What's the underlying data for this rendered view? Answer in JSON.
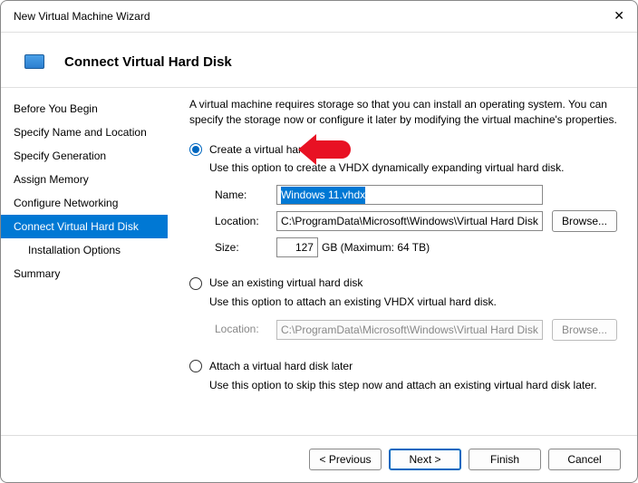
{
  "window": {
    "title": "New Virtual Machine Wizard"
  },
  "header": {
    "title": "Connect Virtual Hard Disk"
  },
  "sidebar": {
    "items": [
      {
        "label": "Before You Begin"
      },
      {
        "label": "Specify Name and Location"
      },
      {
        "label": "Specify Generation"
      },
      {
        "label": "Assign Memory"
      },
      {
        "label": "Configure Networking"
      },
      {
        "label": "Connect Virtual Hard Disk"
      },
      {
        "label": "Installation Options"
      },
      {
        "label": "Summary"
      }
    ]
  },
  "content": {
    "intro": "A virtual machine requires storage so that you can install an operating system. You can specify the storage now or configure it later by modifying the virtual machine's properties.",
    "opt1": {
      "label": "Create a virtual hard disk",
      "desc": "Use this option to create a VHDX dynamically expanding virtual hard disk.",
      "name_label": "Name:",
      "name_value": "Windows 11.vhdx",
      "loc_label": "Location:",
      "loc_value": "C:\\ProgramData\\Microsoft\\Windows\\Virtual Hard Disks\\",
      "browse": "Browse...",
      "size_label": "Size:",
      "size_value": "127",
      "size_unit": "GB (Maximum: 64 TB)"
    },
    "opt2": {
      "label": "Use an existing virtual hard disk",
      "desc": "Use this option to attach an existing VHDX virtual hard disk.",
      "loc_label": "Location:",
      "loc_value": "C:\\ProgramData\\Microsoft\\Windows\\Virtual Hard Disks\\",
      "browse": "Browse..."
    },
    "opt3": {
      "label": "Attach a virtual hard disk later",
      "desc": "Use this option to skip this step now and attach an existing virtual hard disk later."
    }
  },
  "footer": {
    "previous": "< Previous",
    "next": "Next >",
    "finish": "Finish",
    "cancel": "Cancel"
  }
}
